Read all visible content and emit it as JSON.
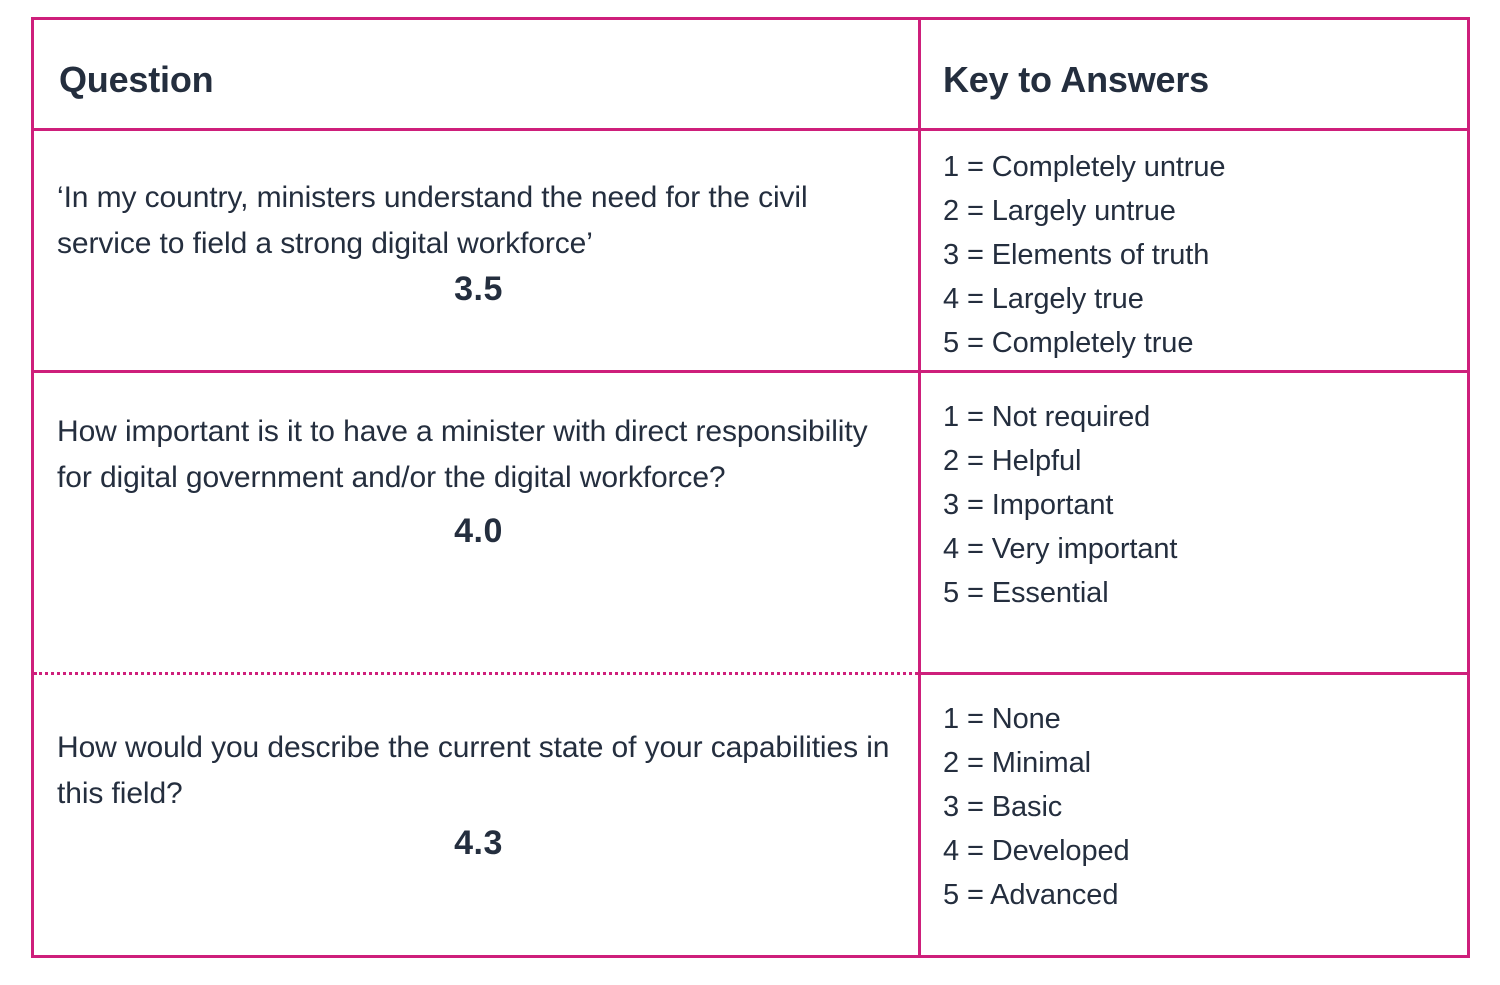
{
  "table": {
    "headers": {
      "question": "Question",
      "key": "Key to Answers"
    },
    "rows": [
      {
        "question": "‘In my country, ministers understand the need for the civil service to field a strong digital workforce’",
        "score": "3.5",
        "key_items": [
          "1 = Completely untrue",
          "2 = Largely untrue",
          "3 = Elements of truth",
          "4 = Largely true",
          "5 = Completely true"
        ]
      },
      {
        "question": "How important is it to have a minister with direct responsibility for digital government and/or the digital workforce?",
        "score": "4.0",
        "key_items": [
          "1 = Not required",
          "2 = Helpful",
          "3 = Important",
          "4 = Very important",
          "5 = Essential"
        ]
      },
      {
        "question": "How would you describe the current state of your capabilities in this field?",
        "score": "4.3",
        "key_items": [
          "1 = None",
          "2 = Minimal",
          "3 = Basic",
          "4 = Developed",
          "5 = Advanced"
        ]
      }
    ]
  },
  "colors": {
    "rule": "#CE1F7B",
    "text": "#242E3E",
    "background": "#FFFFFF"
  }
}
